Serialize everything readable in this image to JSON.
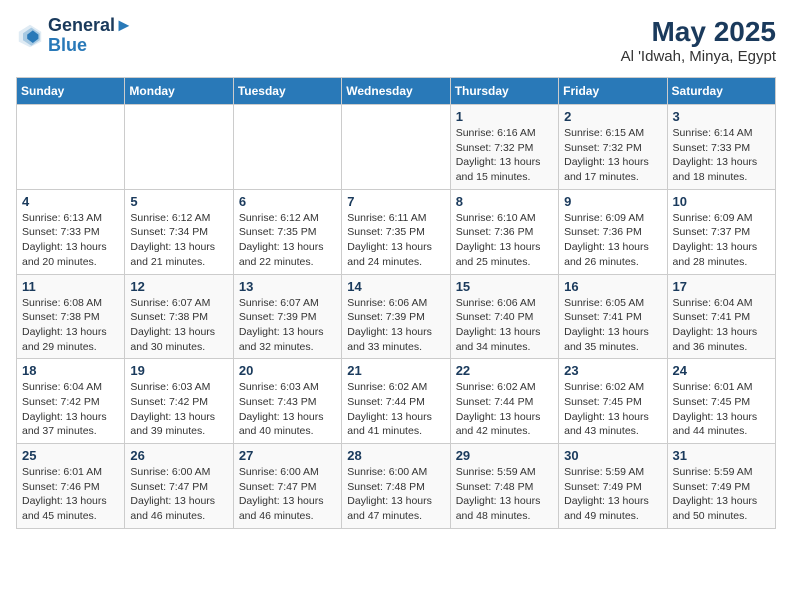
{
  "logo": {
    "line1": "General",
    "line2": "Blue"
  },
  "title": "May 2025",
  "subtitle": "Al 'Idwah, Minya, Egypt",
  "days_of_week": [
    "Sunday",
    "Monday",
    "Tuesday",
    "Wednesday",
    "Thursday",
    "Friday",
    "Saturday"
  ],
  "weeks": [
    [
      {
        "day": "",
        "info": ""
      },
      {
        "day": "",
        "info": ""
      },
      {
        "day": "",
        "info": ""
      },
      {
        "day": "",
        "info": ""
      },
      {
        "day": "1",
        "info": "Sunrise: 6:16 AM\nSunset: 7:32 PM\nDaylight: 13 hours and 15 minutes."
      },
      {
        "day": "2",
        "info": "Sunrise: 6:15 AM\nSunset: 7:32 PM\nDaylight: 13 hours and 17 minutes."
      },
      {
        "day": "3",
        "info": "Sunrise: 6:14 AM\nSunset: 7:33 PM\nDaylight: 13 hours and 18 minutes."
      }
    ],
    [
      {
        "day": "4",
        "info": "Sunrise: 6:13 AM\nSunset: 7:33 PM\nDaylight: 13 hours and 20 minutes."
      },
      {
        "day": "5",
        "info": "Sunrise: 6:12 AM\nSunset: 7:34 PM\nDaylight: 13 hours and 21 minutes."
      },
      {
        "day": "6",
        "info": "Sunrise: 6:12 AM\nSunset: 7:35 PM\nDaylight: 13 hours and 22 minutes."
      },
      {
        "day": "7",
        "info": "Sunrise: 6:11 AM\nSunset: 7:35 PM\nDaylight: 13 hours and 24 minutes."
      },
      {
        "day": "8",
        "info": "Sunrise: 6:10 AM\nSunset: 7:36 PM\nDaylight: 13 hours and 25 minutes."
      },
      {
        "day": "9",
        "info": "Sunrise: 6:09 AM\nSunset: 7:36 PM\nDaylight: 13 hours and 26 minutes."
      },
      {
        "day": "10",
        "info": "Sunrise: 6:09 AM\nSunset: 7:37 PM\nDaylight: 13 hours and 28 minutes."
      }
    ],
    [
      {
        "day": "11",
        "info": "Sunrise: 6:08 AM\nSunset: 7:38 PM\nDaylight: 13 hours and 29 minutes."
      },
      {
        "day": "12",
        "info": "Sunrise: 6:07 AM\nSunset: 7:38 PM\nDaylight: 13 hours and 30 minutes."
      },
      {
        "day": "13",
        "info": "Sunrise: 6:07 AM\nSunset: 7:39 PM\nDaylight: 13 hours and 32 minutes."
      },
      {
        "day": "14",
        "info": "Sunrise: 6:06 AM\nSunset: 7:39 PM\nDaylight: 13 hours and 33 minutes."
      },
      {
        "day": "15",
        "info": "Sunrise: 6:06 AM\nSunset: 7:40 PM\nDaylight: 13 hours and 34 minutes."
      },
      {
        "day": "16",
        "info": "Sunrise: 6:05 AM\nSunset: 7:41 PM\nDaylight: 13 hours and 35 minutes."
      },
      {
        "day": "17",
        "info": "Sunrise: 6:04 AM\nSunset: 7:41 PM\nDaylight: 13 hours and 36 minutes."
      }
    ],
    [
      {
        "day": "18",
        "info": "Sunrise: 6:04 AM\nSunset: 7:42 PM\nDaylight: 13 hours and 37 minutes."
      },
      {
        "day": "19",
        "info": "Sunrise: 6:03 AM\nSunset: 7:42 PM\nDaylight: 13 hours and 39 minutes."
      },
      {
        "day": "20",
        "info": "Sunrise: 6:03 AM\nSunset: 7:43 PM\nDaylight: 13 hours and 40 minutes."
      },
      {
        "day": "21",
        "info": "Sunrise: 6:02 AM\nSunset: 7:44 PM\nDaylight: 13 hours and 41 minutes."
      },
      {
        "day": "22",
        "info": "Sunrise: 6:02 AM\nSunset: 7:44 PM\nDaylight: 13 hours and 42 minutes."
      },
      {
        "day": "23",
        "info": "Sunrise: 6:02 AM\nSunset: 7:45 PM\nDaylight: 13 hours and 43 minutes."
      },
      {
        "day": "24",
        "info": "Sunrise: 6:01 AM\nSunset: 7:45 PM\nDaylight: 13 hours and 44 minutes."
      }
    ],
    [
      {
        "day": "25",
        "info": "Sunrise: 6:01 AM\nSunset: 7:46 PM\nDaylight: 13 hours and 45 minutes."
      },
      {
        "day": "26",
        "info": "Sunrise: 6:00 AM\nSunset: 7:47 PM\nDaylight: 13 hours and 46 minutes."
      },
      {
        "day": "27",
        "info": "Sunrise: 6:00 AM\nSunset: 7:47 PM\nDaylight: 13 hours and 46 minutes."
      },
      {
        "day": "28",
        "info": "Sunrise: 6:00 AM\nSunset: 7:48 PM\nDaylight: 13 hours and 47 minutes."
      },
      {
        "day": "29",
        "info": "Sunrise: 5:59 AM\nSunset: 7:48 PM\nDaylight: 13 hours and 48 minutes."
      },
      {
        "day": "30",
        "info": "Sunrise: 5:59 AM\nSunset: 7:49 PM\nDaylight: 13 hours and 49 minutes."
      },
      {
        "day": "31",
        "info": "Sunrise: 5:59 AM\nSunset: 7:49 PM\nDaylight: 13 hours and 50 minutes."
      }
    ]
  ]
}
